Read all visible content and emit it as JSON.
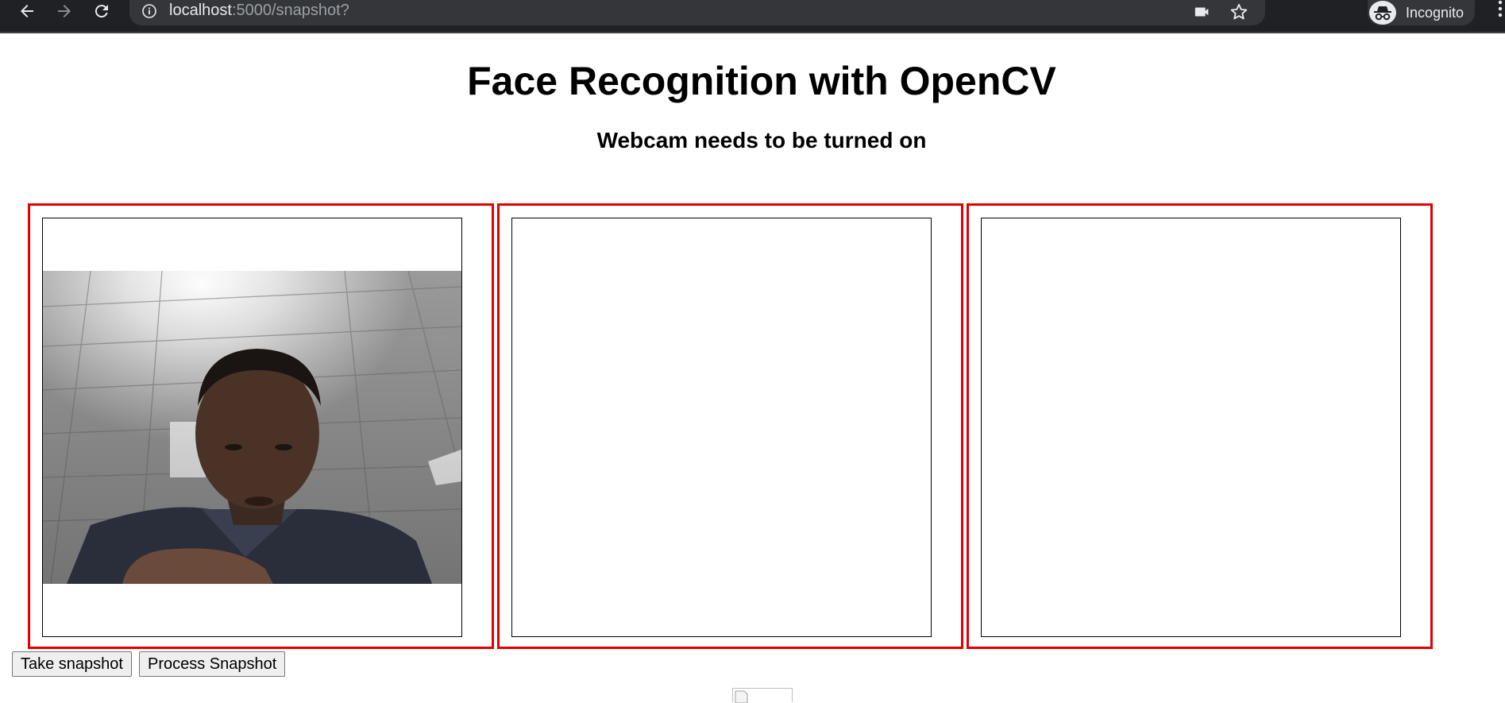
{
  "browser": {
    "url_host": "localhost",
    "url_path": ":5000/snapshot?",
    "profile_label": "Incognito",
    "icons": [
      "back-icon",
      "forward-icon",
      "reload-icon",
      "info-icon",
      "camera-icon",
      "star-icon",
      "incognito-icon",
      "kebab-menu-icon"
    ]
  },
  "page": {
    "title": "Face Recognition with OpenCV",
    "subtitle": "Webcam needs to be turned on"
  },
  "panels": [
    {
      "name": "webcam-panel",
      "content": "webcam feed"
    },
    {
      "name": "snapshot-panel",
      "content": "empty"
    },
    {
      "name": "processed-panel",
      "content": "empty"
    }
  ],
  "actions": {
    "take_snapshot": "Take snapshot",
    "process_snapshot": "Process Snapshot"
  },
  "colors": {
    "panel_border": "#e00000",
    "chrome_bg": "#202124",
    "omnibox_bg": "#35363a"
  }
}
